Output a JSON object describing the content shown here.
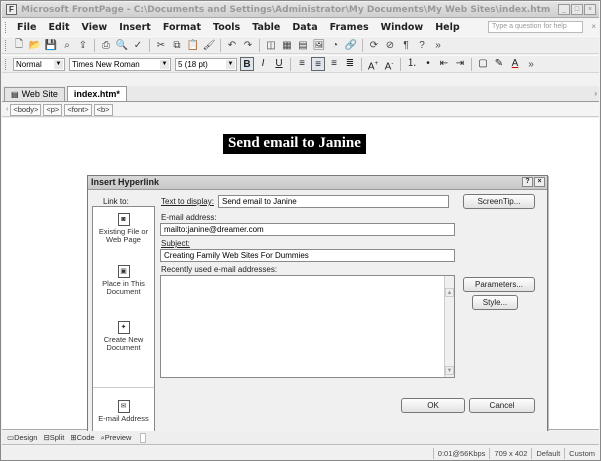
{
  "window": {
    "title": "Microsoft FrontPage - C:\\Documents and Settings\\Administrator\\My Documents\\My Web Sites\\index.htm"
  },
  "menu": {
    "items": [
      "File",
      "Edit",
      "View",
      "Insert",
      "Format",
      "Tools",
      "Table",
      "Data",
      "Frames",
      "Window",
      "Help"
    ],
    "help_placeholder": "Type a question for help"
  },
  "toolbar": {
    "style_value": "Normal",
    "font_value": "Times New Roman",
    "size_value": "5 (18 pt)"
  },
  "tabs": [
    {
      "label": "Web Site"
    },
    {
      "label": "index.htm*"
    }
  ],
  "tag_selector": [
    "<body>",
    "<p>",
    "<font>",
    "<b>"
  ],
  "document": {
    "heading": "Send email to Janine"
  },
  "dialog": {
    "title": "Insert Hyperlink",
    "link_to_label": "Link to:",
    "text_to_display_label": "Text to display:",
    "text_to_display_value": "Send email to Janine",
    "screentip_button": "ScreenTip...",
    "email_address_label": "E-mail address:",
    "email_address_value": "mailto:janine@dreamer.com",
    "subject_label": "Subject:",
    "subject_value": "Creating Family Web Sites For Dummies",
    "recent_label": "Recently used e-mail addresses:",
    "parameters_button": "Parameters...",
    "style_button": "Style...",
    "ok_button": "OK",
    "cancel_button": "Cancel",
    "link_options": [
      {
        "label": "Existing File or Web Page",
        "icon": "web-page-icon"
      },
      {
        "label": "Place in This Document",
        "icon": "document-place-icon"
      },
      {
        "label": "Create New Document",
        "icon": "new-document-icon"
      },
      {
        "label": "E-mail Address",
        "icon": "email-icon",
        "selected": true
      }
    ]
  },
  "view_modes": [
    "Design",
    "Split",
    "Code",
    "Preview"
  ],
  "status": {
    "speed": "0:01@56Kbps",
    "dimensions": "709 x 402",
    "default": "Default",
    "custom": "Custom"
  }
}
